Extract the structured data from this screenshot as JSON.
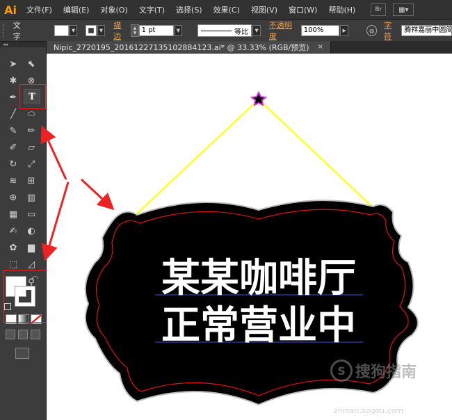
{
  "app": {
    "logo": "Ai"
  },
  "menu": [
    "文件(F)",
    "编辑(E)",
    "对象(O)",
    "文字(T)",
    "选择(S)",
    "效果(C)",
    "视图(V)",
    "窗口(W)",
    "帮助(H)"
  ],
  "menu_controls": {
    "bridge": "Br"
  },
  "controlbar": {
    "tool_label": "文字",
    "stroke_link": "描边",
    "stroke_value": "1 pt",
    "profile_label": "等比",
    "opacity_link": "不透明度",
    "opacity_value": "100%",
    "char_link": "字符",
    "font_value": "腾祥嘉丽中圆简"
  },
  "document": {
    "tab_label": "Nipic_2720195_20161227135102884123.ai* @ 33.33% (RGB/预览)",
    "close": "×"
  },
  "sign": {
    "line1": "某某咖啡厅",
    "line2": "正常营业中"
  },
  "watermark": {
    "brand": "搜狗指南",
    "url": "zhinan.sogou.com",
    "badge": "S"
  },
  "colors": {
    "highlight": "#e22222",
    "rope": "#ffff22",
    "sign_bg": "#000000",
    "sign_border": "#e01010",
    "star_glow": "#e030e0"
  }
}
